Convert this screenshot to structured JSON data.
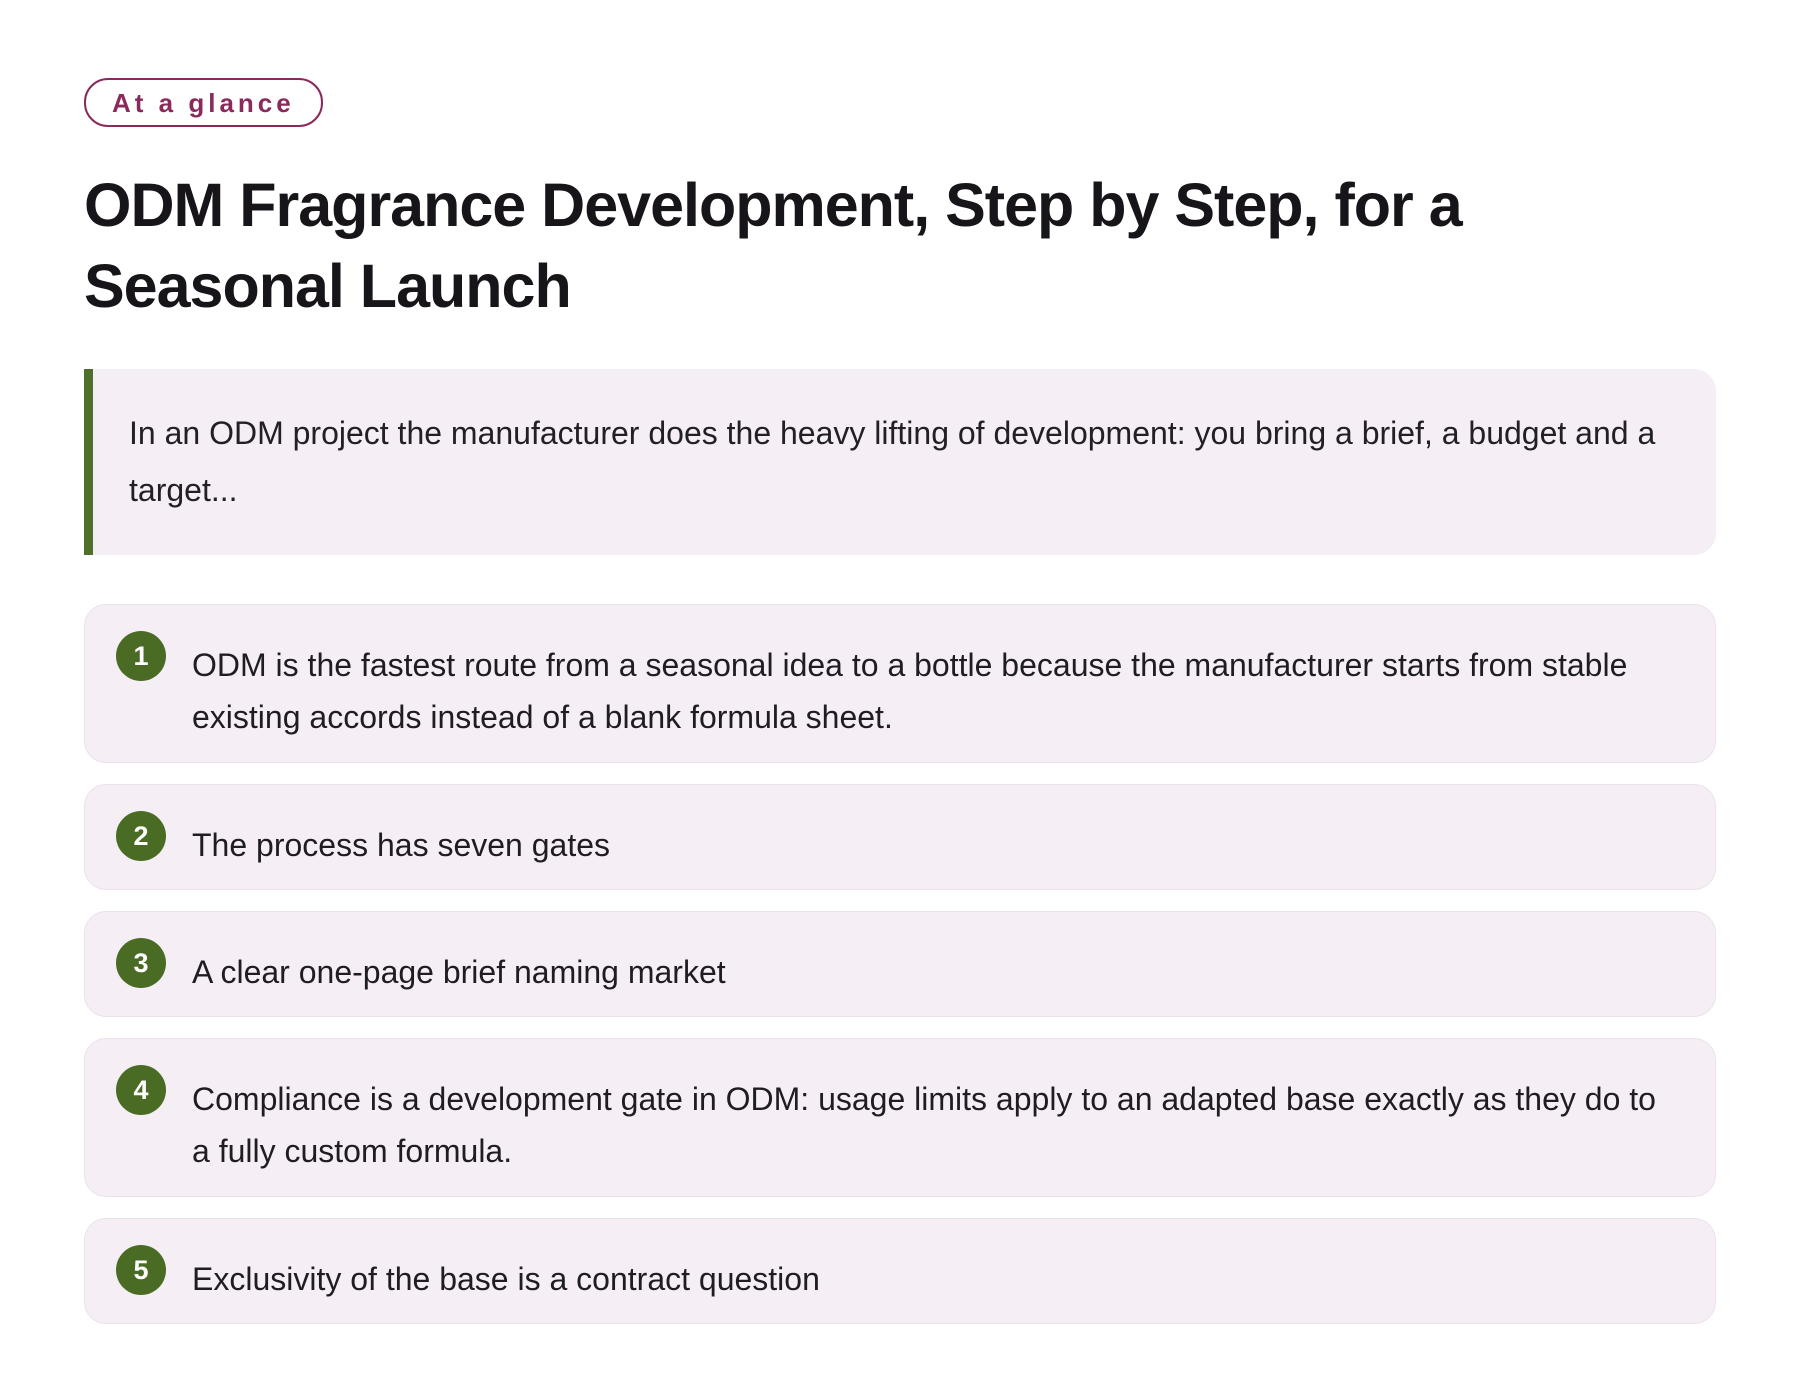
{
  "badge": "At a glance",
  "title": "ODM Fragrance Development, Step by Step, for a Seasonal Launch",
  "intro": "In an ODM project the manufacturer does the heavy lifting of development: you bring a brief, a budget and a target...",
  "items": [
    {
      "number": "1",
      "text": "ODM is the fastest route from a seasonal idea to a bottle because the manufacturer starts from stable existing accords instead of a blank formula sheet."
    },
    {
      "number": "2",
      "text": "The process has seven gates"
    },
    {
      "number": "3",
      "text": "A clear one-page brief naming market"
    },
    {
      "number": "4",
      "text": "Compliance is a development gate in ODM: usage limits apply to an adapted base exactly as they do to a fully custom formula."
    },
    {
      "number": "5",
      "text": "Exclusivity of the base is a contract question"
    }
  ],
  "colors": {
    "accent": "#8a2a5a",
    "bar": "#4f6f2a",
    "number_bg": "#4a6b24",
    "card_bg": "#f5eff5"
  }
}
